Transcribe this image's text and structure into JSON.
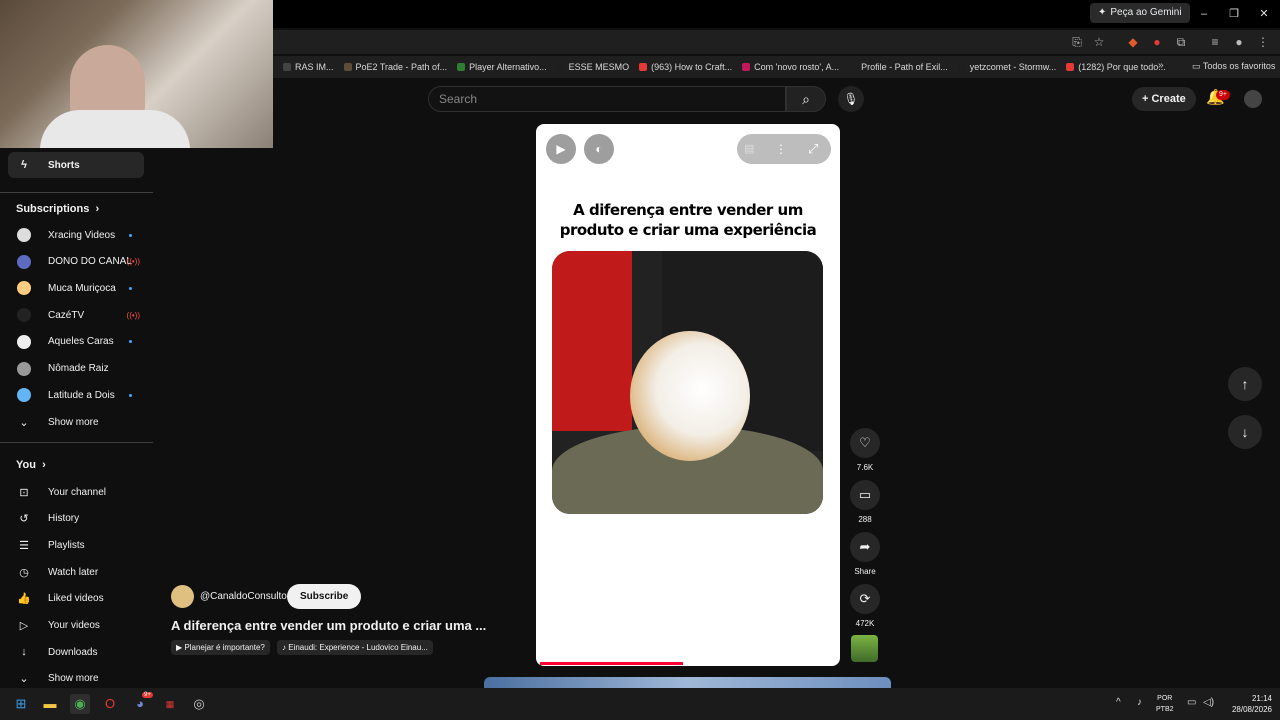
{
  "browser": {
    "gemini_label": "Peça ao Gemini",
    "bookmarks": [
      {
        "label": "RAS IM...",
        "color": "#444"
      },
      {
        "label": "PoE2 Trade - Path of...",
        "color": "#5d4e37"
      },
      {
        "label": "Player Alternativo...",
        "color": "#2e7d32"
      },
      {
        "label": "ESSE MESMO",
        "color": "#1e1e1e"
      },
      {
        "label": "(963) How to Craft...",
        "color": "#e53935"
      },
      {
        "label": "Com 'novo rosto', A...",
        "color": "#c2185b"
      },
      {
        "label": "Profile - Path of Exil...",
        "color": "#1e1e1e"
      },
      {
        "label": "yetzcomet - Stormw...",
        "color": "#1e1e1e"
      },
      {
        "label": "(1282) Por que todo...",
        "color": "#e53935"
      }
    ],
    "all_bookmarks": "Todos os favoritos"
  },
  "header": {
    "search_placeholder": "Search",
    "create_label": "Create",
    "notif_badge": "9+"
  },
  "sidebar": {
    "shorts_label": "Shorts",
    "subscriptions_title": "Subscriptions",
    "subscriptions": [
      {
        "label": "Xracing Videos",
        "status": "new",
        "avatar_color": "#ddd"
      },
      {
        "label": "DONO DO CANAL",
        "status": "live",
        "avatar_color": "#5c6bc0"
      },
      {
        "label": "Muca Muriçoca",
        "status": "new",
        "avatar_color": "#ffcc80"
      },
      {
        "label": "CazéTV",
        "status": "live",
        "avatar_color": "#222"
      },
      {
        "label": "Aqueles Caras",
        "status": "new",
        "avatar_color": "#eee"
      },
      {
        "label": "Nômade Raiz",
        "status": "",
        "avatar_color": "#999"
      },
      {
        "label": "Latitude a Dois",
        "status": "new",
        "avatar_color": "#64b5f6"
      }
    ],
    "subs_show_more": "Show more",
    "you_title": "You",
    "you_items": [
      {
        "label": "Your channel",
        "icon": "channel-icon"
      },
      {
        "label": "History",
        "icon": "history-icon"
      },
      {
        "label": "Playlists",
        "icon": "playlists-icon"
      },
      {
        "label": "Watch later",
        "icon": "clock-icon"
      },
      {
        "label": "Liked videos",
        "icon": "thumb-up-icon"
      },
      {
        "label": "Your videos",
        "icon": "video-icon"
      },
      {
        "label": "Downloads",
        "icon": "download-icon"
      }
    ],
    "you_show_more": "Show more",
    "live_glyph": "((•))"
  },
  "short": {
    "caption": "A diferença entre vender um produto e criar uma experiência",
    "progress": 0.47,
    "likes": "7.6K",
    "comments": "288",
    "share": "Share",
    "remixes": "472K",
    "channel": "@CanaldoConsultor",
    "subscribe": "Subscribe",
    "title": "A diferença entre vender um produto e criar uma ...",
    "chips": [
      "Planejar é importante?",
      "Einaudi: Experience - Ludovico Einau..."
    ]
  },
  "taskbar": {
    "lang_top": "POR",
    "lang_bottom": "PTB2",
    "time": "21:14",
    "date": "28/08/2026",
    "discord_badge": "9+"
  }
}
